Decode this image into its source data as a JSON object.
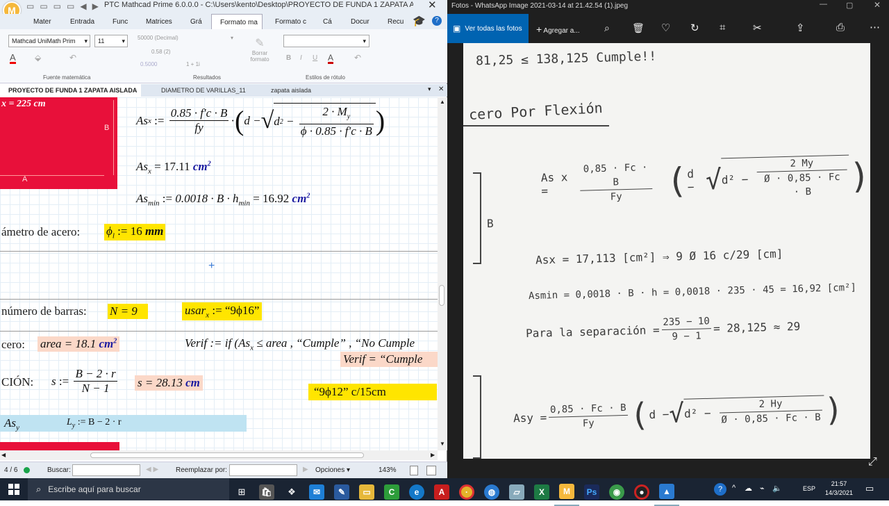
{
  "mathcad": {
    "title": "PTC Mathcad Prime 6.0.0.0 - C:\\Users\\kento\\Desktop\\PROYECTO DE FUNDA 1 ZAPATA AISLADA.mcdx",
    "logo": "M",
    "ribbon_tabs": [
      "Mater",
      "Entrada",
      "Func",
      "Matrices",
      "Grá",
      "Formato ma",
      "Formato c",
      "Cá",
      "Docur",
      "Recu"
    ],
    "font_name": "Mathcad UniMath Prim",
    "font_size": "11",
    "result_format": "50000 (Decimal)",
    "result_val1": "0.58 (2)",
    "result_val2": "0.5000",
    "result_val3": "1 + 1i",
    "clear_format": "Borrar formato",
    "group_labels": [
      "Fuente matemática",
      "Resultados",
      "Estilos de rótulo"
    ],
    "doc_tabs": [
      "PROYECTO DE FUNDA 1 ZAPATA AISLADA",
      "DIAMETRO DE VARILLAS_11",
      "zapata aislada"
    ],
    "ws": {
      "top_label": "x = 225 cm",
      "fig_label_b": "B",
      "fig_label_a": "A",
      "asx_lhs": "As",
      "asx_sub": "x",
      "asx_num": "0.85 · f′c · B",
      "asx_den": "fy",
      "asx_inner_num": "2 · M",
      "asx_inner_num_sub": "y",
      "asx_inner_den": "ϕ · 0.85 · f′c · B",
      "asx_result": "17.11",
      "unit_cm2": "cm",
      "asmin_expr": "0.0018 · B · h",
      "asmin_sub": "min",
      "asmin_result": "16.92",
      "diam_label": "ámetro de acero:",
      "phi_expr": "ϕ",
      "phi_sub": "l",
      "phi_val": "16",
      "unit_mm": "mm",
      "nbar_label": "número de barras:",
      "n_expr": "N = 9",
      "usar_lhs": "usar",
      "usar_val": "“9ϕ16”",
      "acero_label": "cero:",
      "area_expr": "area = 18.1",
      "verif_expr": "Verif := if (As",
      "verif_rest": " ≤ area , “Cumple” , “No Cumple",
      "verif_result": "Verif = “Cumple",
      "sep_label": "CIÓN:",
      "s_num": "B − 2 · r",
      "s_den": "N − 1",
      "s_result": "s = 28.13",
      "unit_cm": "cm",
      "s_text": "“9ϕ12” c/15cm",
      "asy": "As",
      "asy_sub": "y",
      "ly_expr": "L",
      "ly_sub": "y",
      "ly_rest": " := B − 2 · r"
    },
    "status": {
      "page": "4 / 6",
      "search_label": "Buscar:",
      "replace_label": "Reemplazar por:",
      "options": "Opciones",
      "zoom": "143%"
    }
  },
  "photos": {
    "title": "Fotos - WhatsApp Image 2021-03-14 at 21.42.54 (1).jpeg",
    "see_all": "Ver todas las fotos",
    "add_to": "Agregar a...",
    "notes": {
      "l1": "81,25 ≤ 138,125   Cumple!!",
      "l2": "cero Por Flexión",
      "l3_num": "0,85 · Fc · B",
      "l3_den": "Fy",
      "l3_inner_num": "2 My",
      "l3_inner_den": "Ø · 0,85 · Fc · B",
      "l3_lhs": "As x =",
      "l4": "Asx = 17,113 [cm²]   ⇒ 9 Ø 16 c/29 [cm]",
      "l5": "Asmin = 0,0018 · B · h = 0,0018 · 235 · 45 = 16,92 [cm²]",
      "l6_a": "Para la separación =",
      "l6_num": "235 − 10",
      "l6_den": "9 − 1",
      "l6_b": "= 28,125 ≈ 29",
      "l7_lhs": "Asy =",
      "l7_num": "0,85 · Fc · B",
      "l7_den": "Fy",
      "l7_inner_num": "2 Hy",
      "l7_inner_den": "Ø · 0,85 · Fc · B",
      "fig_b": "B"
    }
  },
  "taskbar": {
    "search_placeholder": "Escribe aquí para buscar",
    "lang": "ESP",
    "time": "21:57",
    "date": "14/3/2021"
  },
  "colors": {
    "accent": "#0a63c9",
    "red": "#e8103a",
    "yellow": "#ffe500",
    "pink": "#fbd8c8",
    "blue_band": "#bfe3f2",
    "taskbar": "#1a2433",
    "photos_toolbar": "#0063b1"
  }
}
